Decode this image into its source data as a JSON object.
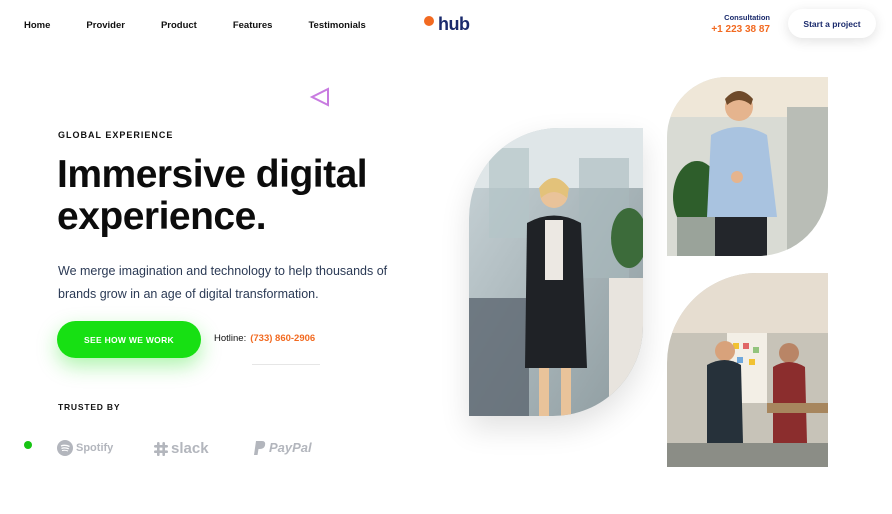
{
  "nav": {
    "links": [
      "Home",
      "Provider",
      "Product",
      "Features",
      "Testimonials"
    ],
    "logo": "hub",
    "consultation_label": "Consultation",
    "consultation_phone": "+1 223 38 87",
    "start_button": "Start a project"
  },
  "hero": {
    "eyebrow": "GLOBAL EXPERIENCE",
    "headline_line1": "Immersive digital",
    "headline_line2": "experience.",
    "subtext": "We merge imagination and technology to help thousands of brands grow in an age of digital transformation.",
    "cta": "SEE HOW WE WORK",
    "hotline_label": "Hotline:",
    "hotline_number": "(733) 860-2906"
  },
  "trusted": {
    "label": "TRUSTED BY",
    "brands": [
      "Spotify",
      "slack",
      "PayPal"
    ]
  },
  "colors": {
    "accent_green": "#17e013",
    "accent_orange": "#f26a21",
    "navy": "#1a2a6c"
  },
  "icons": [
    "logo-dot-icon",
    "triangle-outline-icon",
    "spotify-icon",
    "slack-icon",
    "paypal-icon"
  ]
}
